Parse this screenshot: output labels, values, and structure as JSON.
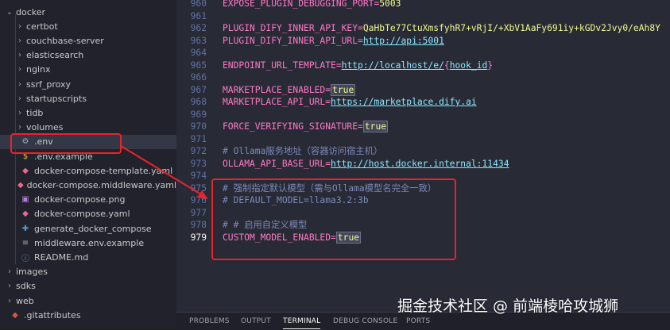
{
  "explorer": {
    "rows": [
      {
        "label": "docker",
        "kind": "folder-open",
        "depth": 0
      },
      {
        "label": "certbot",
        "kind": "folder",
        "depth": 1
      },
      {
        "label": "couchbase-server",
        "kind": "folder",
        "depth": 1
      },
      {
        "label": "elasticsearch",
        "kind": "folder",
        "depth": 1
      },
      {
        "label": "nginx",
        "kind": "folder",
        "depth": 1
      },
      {
        "label": "ssrf_proxy",
        "kind": "folder",
        "depth": 1
      },
      {
        "label": "startupscripts",
        "kind": "folder",
        "depth": 1
      },
      {
        "label": "tidb",
        "kind": "folder",
        "depth": 1
      },
      {
        "label": "volumes",
        "kind": "folder",
        "depth": 1
      },
      {
        "label": ".env",
        "kind": "gear",
        "depth": 1,
        "selected": true
      },
      {
        "label": ".env.example",
        "kind": "dollar",
        "depth": 1
      },
      {
        "label": "docker-compose-template.yaml",
        "kind": "docker",
        "depth": 1
      },
      {
        "label": "docker-compose.middleware.yaml",
        "kind": "docker",
        "depth": 1
      },
      {
        "label": "docker-compose.png",
        "kind": "image",
        "depth": 1
      },
      {
        "label": "docker-compose.yaml",
        "kind": "docker",
        "depth": 1
      },
      {
        "label": "generate_docker_compose",
        "kind": "python",
        "depth": 1
      },
      {
        "label": "middleware.env.example",
        "kind": "lines",
        "depth": 1
      },
      {
        "label": "README.md",
        "kind": "info",
        "depth": 1
      },
      {
        "label": "images",
        "kind": "folder",
        "depth": 0
      },
      {
        "label": "sdks",
        "kind": "folder",
        "depth": 0
      },
      {
        "label": "web",
        "kind": "folder",
        "depth": 0
      },
      {
        "label": ".gitattributes",
        "kind": "git",
        "depth": 0
      }
    ]
  },
  "editor": {
    "active_line": "979",
    "lines": [
      {
        "n": "960",
        "key": "EXPOSE_PLUGIN_DEBUGGING_PORT",
        "val": "5003"
      },
      {
        "n": "961"
      },
      {
        "n": "962",
        "key": "PLUGIN_DIFY_INNER_API_KEY",
        "val": "QaHbTe77CtuXmsfyhR7+vRjI/+XbV1AaFy691iy+kGDv2Jvy0/eAh8Y"
      },
      {
        "n": "963",
        "key": "PLUGIN_DIFY_INNER_API_URL",
        "url": "http://api:5001"
      },
      {
        "n": "964"
      },
      {
        "n": "965",
        "key": "ENDPOINT_URL_TEMPLATE",
        "url": "http://localhost/e/",
        "brace_open": "{",
        "brace_key": "hook_id",
        "brace_close": "}"
      },
      {
        "n": "966"
      },
      {
        "n": "967",
        "key": "MARKETPLACE_ENABLED",
        "tval": "true"
      },
      {
        "n": "968",
        "key": "MARKETPLACE_API_URL",
        "url": "https://marketplace.dify.ai"
      },
      {
        "n": "969"
      },
      {
        "n": "970",
        "key": "FORCE_VERIFYING_SIGNATURE",
        "tval": "true"
      },
      {
        "n": "971"
      },
      {
        "n": "972",
        "comment": "# Ollama服务地址（容器访问宿主机）"
      },
      {
        "n": "973",
        "key": "OLLAMA_API_BASE_URL",
        "url": "http://host.docker.internal:11434"
      },
      {
        "n": "974"
      },
      {
        "n": "975",
        "comment": "# 强制指定默认模型（需与Ollama模型名完全一致）"
      },
      {
        "n": "976",
        "comment": "# DEFAULT_MODEL=llama3.2:3b"
      },
      {
        "n": "977"
      },
      {
        "n": "978",
        "comment": "# # 启用自定义模型"
      },
      {
        "n": "979",
        "key": "CUSTOM_MODEL_ENABLED",
        "tval": "true"
      }
    ]
  },
  "panel": {
    "tabs": [
      "PROBLEMS",
      "OUTPUT",
      "TERMINAL",
      "DEBUG CONSOLE",
      "PORTS"
    ],
    "active_tab": "TERMINAL"
  },
  "watermark": "掘金技术社区 @ 前端棱哈攻城狮",
  "colors": {
    "annotation_red": "#e8242a",
    "key": "#ff79c6",
    "string": "#f1fa8c",
    "url": "#8be9fd",
    "comment": "#7d8ab8"
  }
}
